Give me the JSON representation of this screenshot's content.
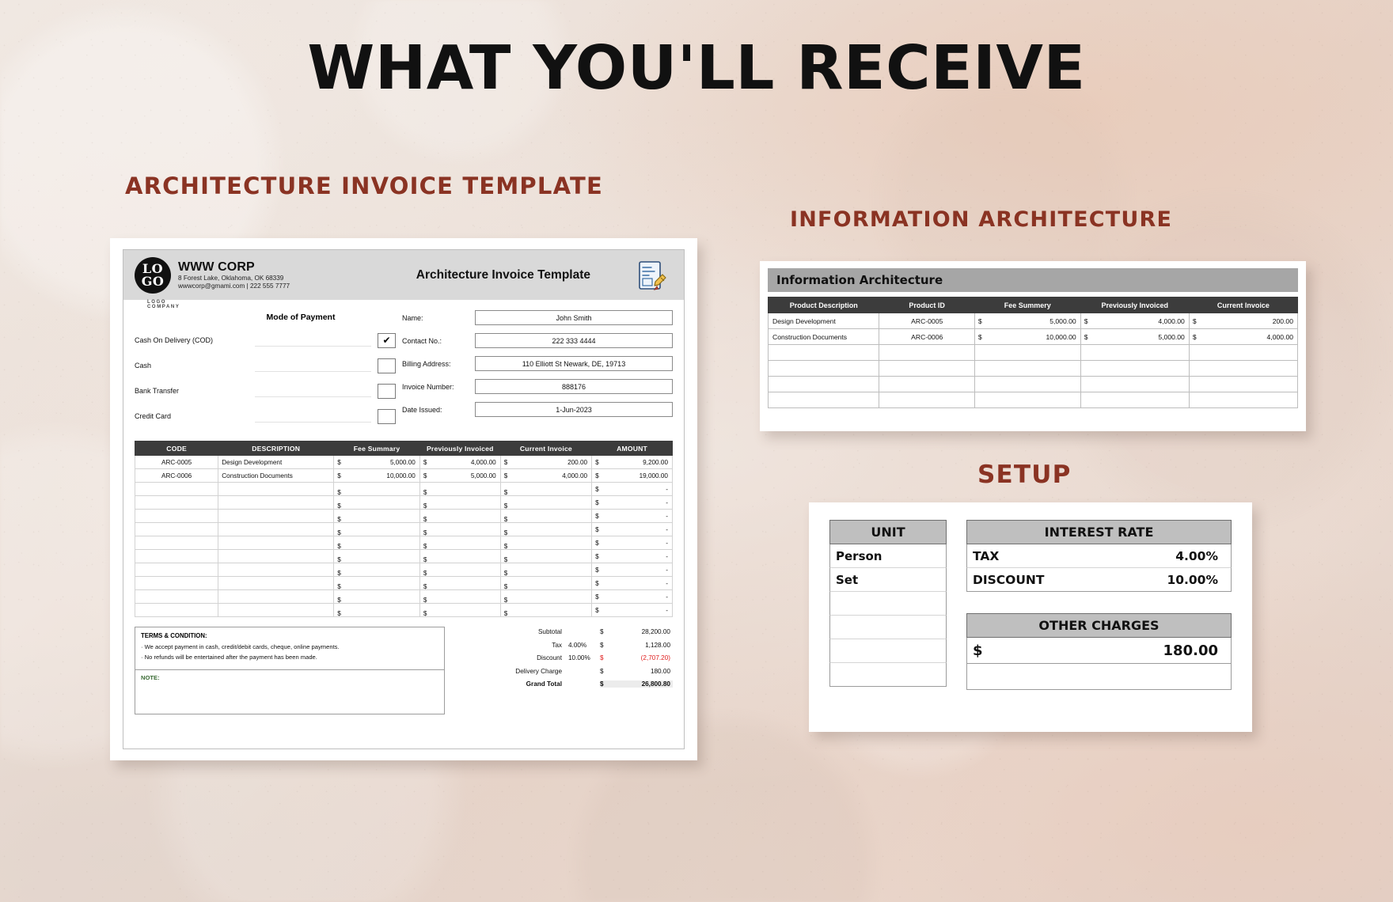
{
  "headline": "WHAT YOU'LL RECEIVE",
  "sections": {
    "invoice_title": "ARCHITECTURE INVOICE TEMPLATE",
    "ia_title": "INFORMATION ARCHITECTURE",
    "setup_title": "SETUP"
  },
  "invoice": {
    "logo": {
      "line1": "LO",
      "line2": "GO",
      "caption": "LOGO COMPANY"
    },
    "company": {
      "name": "WWW CORP",
      "address": "8 Forest Lake, Oklahoma, OK 68339",
      "contact": "wwwcorp@gmami.com | 222 555 7777"
    },
    "doc_title": "Architecture Invoice Template",
    "payment": {
      "heading": "Mode of Payment",
      "options": [
        {
          "label": "Cash On Delivery (COD)",
          "checked": "✔"
        },
        {
          "label": "Cash",
          "checked": ""
        },
        {
          "label": "Bank Transfer",
          "checked": ""
        },
        {
          "label": "Credit Card",
          "checked": ""
        }
      ]
    },
    "customer": [
      {
        "label": "Name:",
        "value": "John Smith"
      },
      {
        "label": "Contact No.:",
        "value": "222 333 4444"
      },
      {
        "label": "Billing Address:",
        "value": "110 Elliott St Newark, DE, 19713"
      },
      {
        "label": "Invoice Number:",
        "value": "888176"
      },
      {
        "label": "Date Issued:",
        "value": "1-Jun-2023"
      }
    ],
    "table": {
      "headers": [
        "CODE",
        "DESCRIPTION",
        "Fee Summary",
        "Previously Invoiced",
        "Current Invoice",
        "AMOUNT"
      ],
      "rows": [
        {
          "code": "ARC-0005",
          "desc": "Design Development",
          "fee": "5,000.00",
          "prev": "4,000.00",
          "cur": "200.00",
          "amt": "9,200.00"
        },
        {
          "code": "ARC-0006",
          "desc": "Construction Documents",
          "fee": "10,000.00",
          "prev": "5,000.00",
          "cur": "4,000.00",
          "amt": "19,000.00"
        },
        {
          "code": "",
          "desc": "",
          "fee": "",
          "prev": "",
          "cur": "",
          "amt": "-"
        },
        {
          "code": "",
          "desc": "",
          "fee": "",
          "prev": "",
          "cur": "",
          "amt": "-"
        },
        {
          "code": "",
          "desc": "",
          "fee": "",
          "prev": "",
          "cur": "",
          "amt": "-"
        },
        {
          "code": "",
          "desc": "",
          "fee": "",
          "prev": "",
          "cur": "",
          "amt": "-"
        },
        {
          "code": "",
          "desc": "",
          "fee": "",
          "prev": "",
          "cur": "",
          "amt": "-"
        },
        {
          "code": "",
          "desc": "",
          "fee": "",
          "prev": "",
          "cur": "",
          "amt": "-"
        },
        {
          "code": "",
          "desc": "",
          "fee": "",
          "prev": "",
          "cur": "",
          "amt": "-"
        },
        {
          "code": "",
          "desc": "",
          "fee": "",
          "prev": "",
          "cur": "",
          "amt": "-"
        },
        {
          "code": "",
          "desc": "",
          "fee": "",
          "prev": "",
          "cur": "",
          "amt": "-"
        },
        {
          "code": "",
          "desc": "",
          "fee": "",
          "prev": "",
          "cur": "",
          "amt": "-"
        }
      ],
      "currency": "$"
    },
    "terms": {
      "title": "TERMS & CONDITION:",
      "lines": [
        "· We accept payment in cash, credit/debit cards, cheque, online payments.",
        "· No refunds will be entertained after the payment has been made."
      ],
      "note_label": "NOTE:"
    },
    "totals": [
      {
        "label": "Subtotal",
        "pct": "",
        "cur": "$",
        "value": "28,200.00",
        "negative": false,
        "grand": false
      },
      {
        "label": "Tax",
        "pct": "4.00%",
        "cur": "$",
        "value": "1,128.00",
        "negative": false,
        "grand": false
      },
      {
        "label": "Discount",
        "pct": "10.00%",
        "cur": "$",
        "value": "(2,707.20)",
        "negative": true,
        "grand": false
      },
      {
        "label": "Delivery Charge",
        "pct": "",
        "cur": "$",
        "value": "180.00",
        "negative": false,
        "grand": false
      },
      {
        "label": "Grand Total",
        "pct": "",
        "cur": "$",
        "value": "26,800.80",
        "negative": false,
        "grand": true
      }
    ]
  },
  "information_architecture": {
    "banner": "Information Architecture",
    "headers": [
      "Product Description",
      "Product ID",
      "Fee Summery",
      "Previously Invoiced",
      "Current Invoice"
    ],
    "rows": [
      {
        "desc": "Design Development",
        "id": "ARC-0005",
        "fee": "5,000.00",
        "prev": "4,000.00",
        "cur": "200.00"
      },
      {
        "desc": "Construction Documents",
        "id": "ARC-0006",
        "fee": "10,000.00",
        "prev": "5,000.00",
        "cur": "4,000.00"
      },
      {
        "desc": "",
        "id": "",
        "fee": "",
        "prev": "",
        "cur": ""
      },
      {
        "desc": "",
        "id": "",
        "fee": "",
        "prev": "",
        "cur": ""
      },
      {
        "desc": "",
        "id": "",
        "fee": "",
        "prev": "",
        "cur": ""
      },
      {
        "desc": "",
        "id": "",
        "fee": "",
        "prev": "",
        "cur": ""
      }
    ],
    "currency": "$"
  },
  "setup": {
    "unit": {
      "header": "UNIT",
      "items": [
        "Person",
        "Set",
        "",
        "",
        "",
        ""
      ]
    },
    "interest_rate": {
      "header": "INTEREST RATE",
      "rows": [
        {
          "label": "TAX",
          "value": "4.00%"
        },
        {
          "label": "DISCOUNT",
          "value": "10.00%"
        }
      ]
    },
    "other_charges": {
      "header": "OTHER CHARGES",
      "currency": "$",
      "value": "180.00"
    }
  },
  "colors": {
    "accent": "#8a3323",
    "header_dark": "#3c3c3c",
    "banner_grey": "#a6a6a6",
    "negative": "#e02020"
  }
}
